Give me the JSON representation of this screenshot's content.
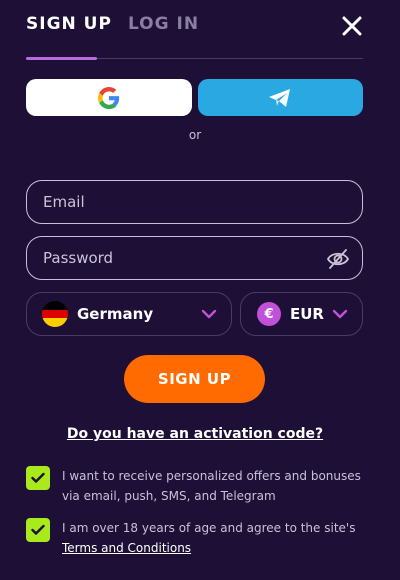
{
  "tabs": {
    "signup": "SIGN UP",
    "login": "LOG IN"
  },
  "icons": {
    "close": "close-icon",
    "google": "google-icon",
    "telegram": "telegram-icon",
    "eye": "eye-off-icon",
    "chevron": "chevron-down-icon",
    "check": "check-icon"
  },
  "social": {
    "or_text": "or"
  },
  "form": {
    "email_placeholder": "Email",
    "password_placeholder": "Password",
    "country": "Germany",
    "currency": "EUR",
    "currency_symbol": "€",
    "submit_label": "SIGN UP",
    "activation_link": "Do you have an activation code?"
  },
  "consents": {
    "offers_text": "I want to receive personalized offers and bonuses via email, push, SMS, and Telegram",
    "offers_checked": true,
    "age_text_prefix": "I am over 18 years of age and agree to the site's ",
    "age_link": "Terms and Conditions",
    "age_checked": true
  },
  "colors": {
    "background": "#1e0f36",
    "accent_orange": "#ff6b00",
    "telegram_blue": "#2aa8e2",
    "checkbox_green": "#a8ea1c",
    "tab_underline": "#b86be0"
  }
}
